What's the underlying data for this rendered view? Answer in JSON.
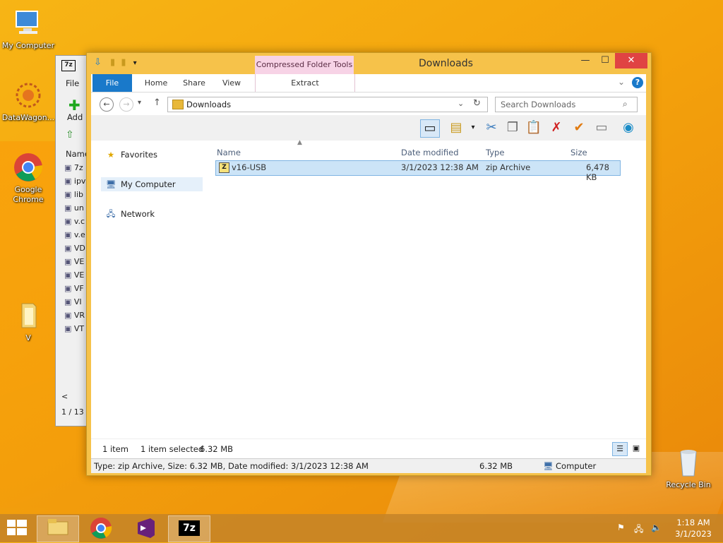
{
  "desktop": {
    "icons": [
      {
        "label": "My Computer"
      },
      {
        "label": "DataWagon..."
      },
      {
        "label": "Google Chrome"
      },
      {
        "label": "V"
      },
      {
        "label": "Recycle Bin"
      }
    ]
  },
  "sevenzip": {
    "menu_file": "File",
    "add_label": "Add",
    "col_name": "Name",
    "rows": [
      "7z",
      "ipv",
      "lib",
      "un",
      "v.c",
      "v.e",
      "VD",
      "VE",
      "VE",
      "VF",
      "VI",
      "VR",
      "VT"
    ],
    "status": "1 / 13"
  },
  "window": {
    "title": "Downloads",
    "context_tab": "Compressed Folder Tools",
    "ribbon_tabs": [
      "File",
      "Home",
      "Share",
      "View"
    ],
    "context_subtab": "Extract",
    "address": "Downloads",
    "search_placeholder": "Search Downloads",
    "nav": {
      "favorites": "Favorites",
      "my_computer": "My Computer",
      "network": "Network"
    },
    "columns": {
      "name": "Name",
      "date": "Date modified",
      "type": "Type",
      "size": "Size"
    },
    "files": [
      {
        "name": "v16-USB",
        "date": "3/1/2023 12:38 AM",
        "type": "zip Archive",
        "size": "6,478 KB"
      }
    ],
    "status": {
      "count": "1 item",
      "selected": "1 item selected",
      "selected_size": "6.32 MB"
    },
    "details_bar": {
      "info": "Type: zip Archive, Size: 6.32 MB, Date modified: 3/1/2023 12:38 AM",
      "size": "6.32 MB",
      "location": "Computer"
    }
  },
  "taskbar": {
    "time": "1:18 AM",
    "date": "3/1/2023"
  },
  "colors": {
    "accent": "#1979ca",
    "selection": "#cce4f7",
    "context_tab": "#f7d3e6",
    "close": "#e04343"
  }
}
